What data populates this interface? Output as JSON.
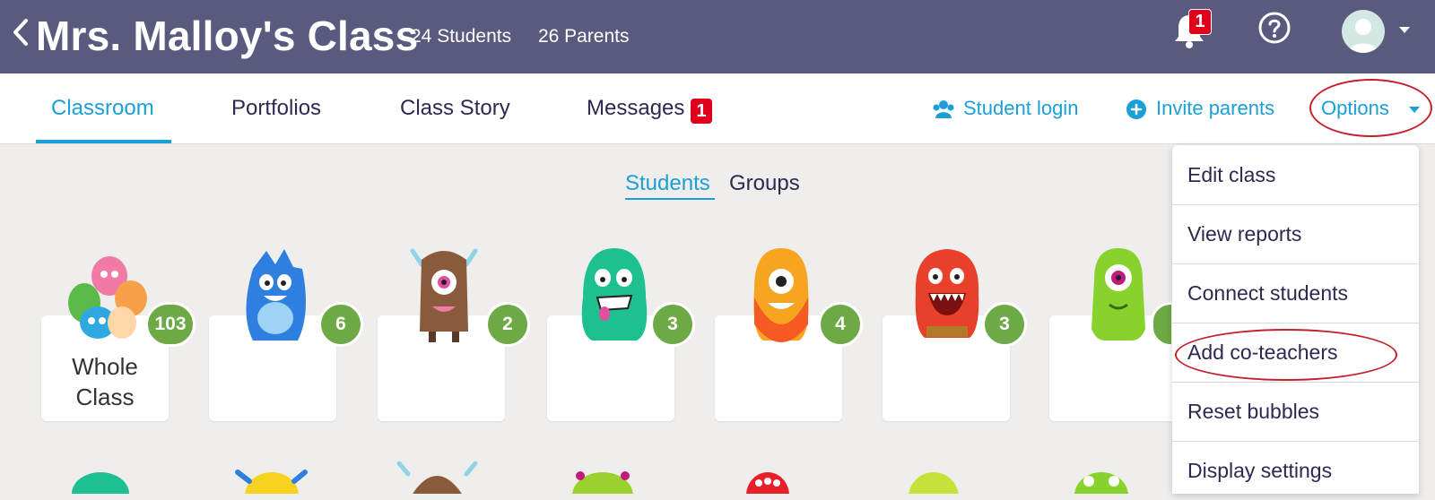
{
  "header": {
    "class_title": "Mrs. Malloy's Class",
    "students_count": "24 Students",
    "parents_count": "26 Parents",
    "notification_count": "1"
  },
  "nav": {
    "tabs": [
      "Classroom",
      "Portfolios",
      "Class Story",
      "Messages"
    ],
    "messages_badge": "1",
    "student_login": "Student login",
    "invite_parents": "Invite parents",
    "options": "Options"
  },
  "subtabs": [
    "Students",
    "Groups"
  ],
  "cards": [
    {
      "label": "Whole Class",
      "points": "103"
    },
    {
      "label": "",
      "points": "6"
    },
    {
      "label": "",
      "points": "2"
    },
    {
      "label": "",
      "points": "3"
    },
    {
      "label": "",
      "points": "4"
    },
    {
      "label": "",
      "points": "3"
    },
    {
      "label": "",
      "points": ""
    }
  ],
  "options_menu": [
    "Edit class",
    "View reports",
    "Connect students",
    "Add co-teachers",
    "Reset bubbles",
    "Display settings"
  ],
  "colors": {
    "header_bg": "#5a5a7e",
    "accent_blue": "#1a9fd6",
    "badge_red": "#e0001b",
    "points_green": "#6da945",
    "annotation_red": "#c6202b"
  }
}
